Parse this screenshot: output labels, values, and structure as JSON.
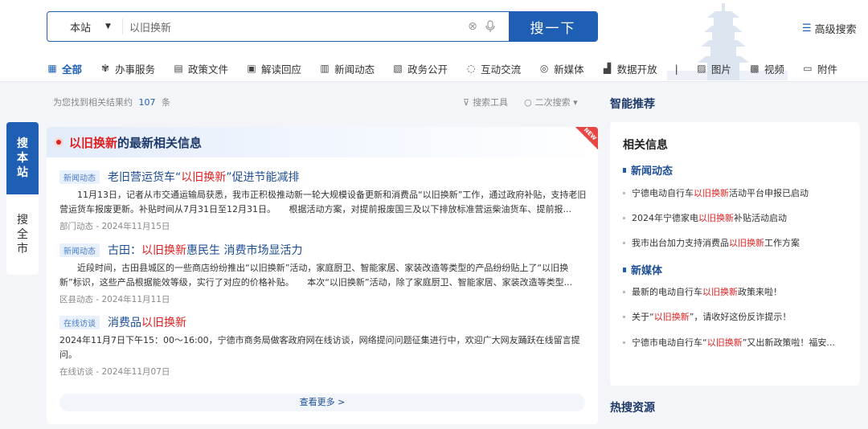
{
  "search": {
    "scope": "本站",
    "query": "以旧换新",
    "button": "搜一下",
    "advanced": "高级搜索"
  },
  "tabs": [
    {
      "icon": "grid-icon",
      "label": "全部"
    },
    {
      "icon": "service-icon",
      "label": "办事服务"
    },
    {
      "icon": "policy-doc-icon",
      "label": "政策文件"
    },
    {
      "icon": "reply-icon",
      "label": "解读回应"
    },
    {
      "icon": "news-icon",
      "label": "新闻动态"
    },
    {
      "icon": "public-doc-icon",
      "label": "政务公开"
    },
    {
      "icon": "chat-icon",
      "label": "互动交流"
    },
    {
      "icon": "media-icon",
      "label": "新媒体"
    },
    {
      "icon": "data-icon",
      "label": "数据开放"
    },
    {
      "icon": "image-icon",
      "label": "图片"
    },
    {
      "icon": "video-icon",
      "label": "视频"
    },
    {
      "icon": "folder-icon",
      "label": "附件"
    }
  ],
  "tab_separator": "|",
  "float_nav": {
    "active": [
      "搜",
      "本",
      "站"
    ],
    "inactive": [
      "搜",
      "全",
      "市"
    ]
  },
  "results": {
    "prefix": "为您找到相关结果约",
    "count": "107",
    "suffix": "条",
    "tools": "搜索工具",
    "secondary": "二次搜索"
  },
  "card": {
    "title_kw": "以旧换新",
    "title_rest": "的最新相关信息",
    "badge": "NEW",
    "see_more": "查看更多 >"
  },
  "items": [
    {
      "tag": "新闻动态",
      "title_pre": "老旧营运货车“",
      "title_kw": "以旧换新",
      "title_post": "”促进节能减排",
      "desc": "　　11月13日，记者从市交通运输局获悉，我市正积极推动新一轮大规模设备更新和消费品“以旧换新”工作，通过政府补贴，支持老旧营运货车报废更新。补贴时间从7月31日至12月31日。　　根据活动方案，对提前报废国三及以下排放标准营运柴油货车、提前报...",
      "meta": "部门动态 - 2024年11月15日"
    },
    {
      "tag": "新闻动态",
      "title_pre": "古田：",
      "title_kw": "以旧换新",
      "title_post": "惠民生 消费市场显活力",
      "desc": "　　近段时间，古田县城区的一些商店纷纷推出“以旧换新”活动，家庭厨卫、智能家居、家装改造等类型的产品纷纷贴上了“以旧换新”标识，这些产品根据能效等级，实行了对应的价格补贴。　　本次“以旧换新”活动，除了家庭厨卫、智能家居、家装改造等类型...",
      "meta": "区县动态 - 2024年11月11日"
    },
    {
      "tag": "在线访谈",
      "title_pre": "消费品",
      "title_kw": "以旧换新",
      "title_post": "",
      "desc": "2024年11月7日下午15：00～16:00，宁德市商务局做客政府网在线访谈，网络提问问题征集进行中，欢迎广大网友踊跃在线留言提问。",
      "meta": "在线访谈 - 2024年11月07日"
    }
  ],
  "right": {
    "section_title": "智能推荐",
    "card_title": "相关信息",
    "news_head": "新闻动态",
    "news": [
      {
        "pre": "宁德电动自行车",
        "kw": "以旧换新",
        "post": "活动平台申报已启动"
      },
      {
        "pre": "2024年宁德家电",
        "kw": "以旧换新",
        "post": "补贴活动启动"
      },
      {
        "pre": "我市出台加力支持消费品",
        "kw": "以旧换新",
        "post": "工作方案"
      }
    ],
    "media_head": "新媒体",
    "media": [
      {
        "pre": "最新的电动自行车",
        "kw": "以旧换新",
        "post": "政策来啦！"
      },
      {
        "pre": "关于“",
        "kw": "以旧换新",
        "post": "”，请收好这份反诈提示！"
      },
      {
        "pre": "宁德市电动自行车“",
        "kw": "以旧换新",
        "post": "”又出新政策啦！福安..."
      }
    ],
    "hot_title": "热搜资源"
  }
}
